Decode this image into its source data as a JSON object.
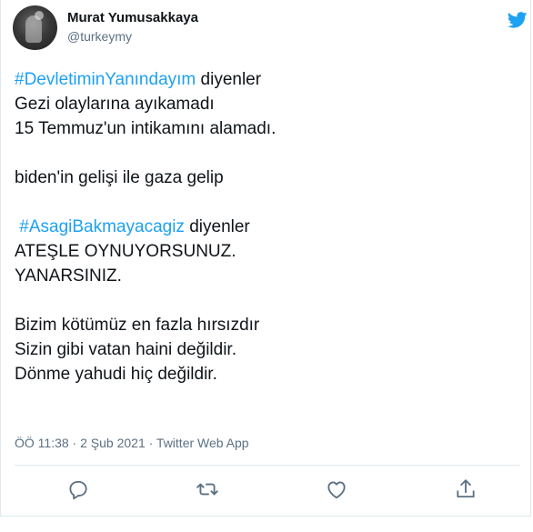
{
  "tweet": {
    "author": {
      "name": "Murat Yumusakkaya",
      "handle": "@turkeymy"
    },
    "lines": [
      {
        "hashtag": "#DevletiminYanındayım",
        "text": " diyenler"
      },
      {
        "text": "Gezi olaylarına ayıkamadı"
      },
      {
        "text": "15 Temmuz'un intikamını alamadı."
      },
      {
        "text": ""
      },
      {
        "text": "biden'in gelişi ile gaza gelip"
      },
      {
        "text": ""
      },
      {
        "hashtag": " #AsagiBakmayacagiz",
        "text": " diyenler"
      },
      {
        "text": "ATEŞLE OYNUYORSUNUZ."
      },
      {
        "text": "YANARSINIZ."
      },
      {
        "text": ""
      },
      {
        "text": "Bizim kötümüz en fazla hırsızdır"
      },
      {
        "text": "Sizin gibi vatan haini değildir."
      },
      {
        "text": "Dönme yahudi hiç değildir."
      }
    ],
    "meta": "ÖÖ 11:38 · 2 Şub 2021 · Twitter Web App"
  },
  "actions": [
    {
      "name": "reply-icon"
    },
    {
      "name": "retweet-icon"
    },
    {
      "name": "like-icon"
    },
    {
      "name": "share-icon"
    }
  ],
  "colors": {
    "accent": "#1da1f2",
    "text": "#0f1419",
    "secondary": "#5b7083",
    "border": "#e1e8ed"
  }
}
